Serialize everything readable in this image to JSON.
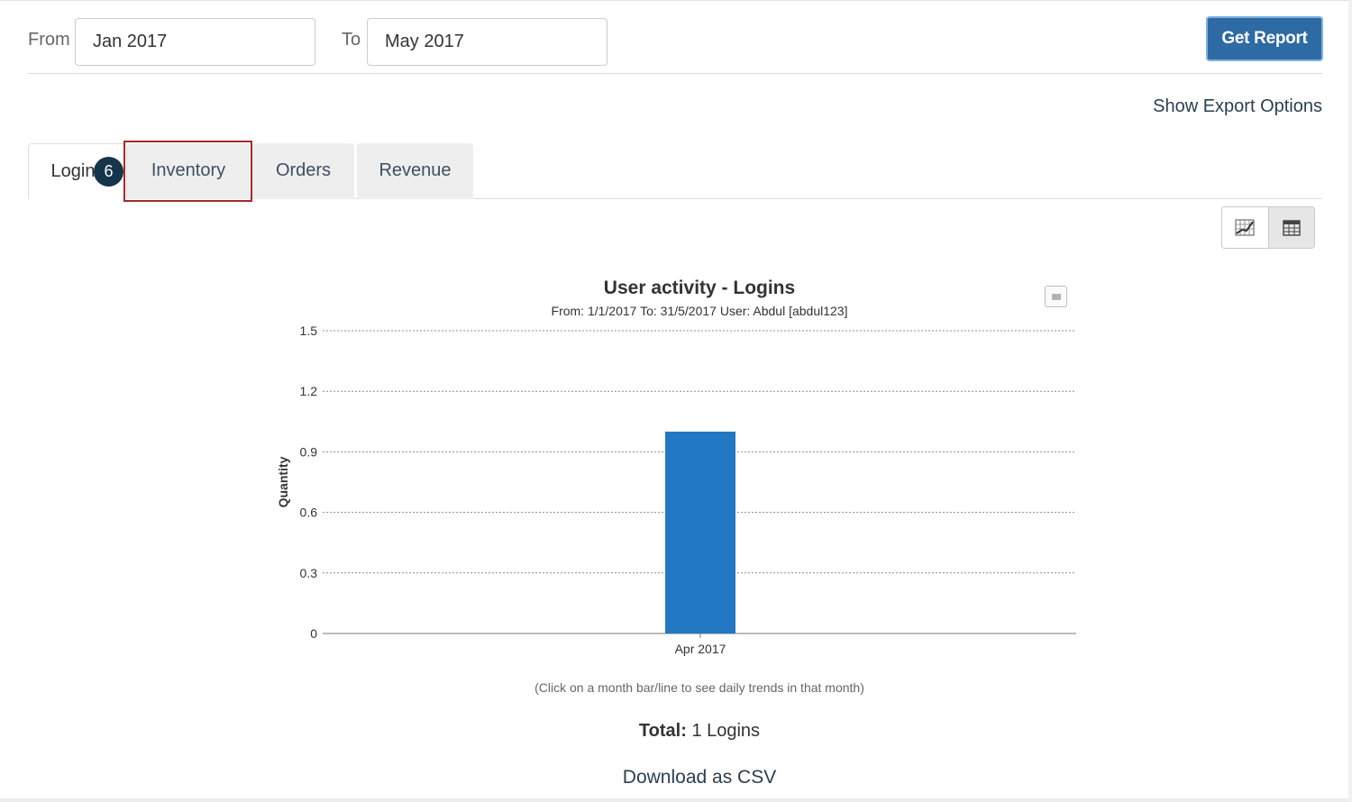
{
  "filters": {
    "from_label": "From",
    "from_value": "Jan 2017",
    "to_label": "To",
    "to_value": "May 2017",
    "get_report_label": "Get Report"
  },
  "export_options_label": "Show Export Options",
  "tabs": [
    {
      "label": "Login",
      "active": true
    },
    {
      "label": "Inventory",
      "active": false
    },
    {
      "label": "Orders",
      "active": false
    },
    {
      "label": "Revenue",
      "active": false
    }
  ],
  "step_badge": "6",
  "view_toggle": {
    "chart_icon": "bar-chart-icon",
    "table_icon": "table-grid-icon"
  },
  "chart_menu_icon": "menu-icon",
  "chart_data": {
    "type": "bar",
    "title": "User activity - Logins",
    "subtitle": "From: 1/1/2017 To: 31/5/2017 User: Abdul [abdul123]",
    "ylabel": "Quantity",
    "xlabel": "",
    "categories": [
      "Apr 2017"
    ],
    "values": [
      1
    ],
    "ylim": [
      0,
      1.5
    ],
    "yticks": [
      "0",
      "0.3",
      "0.6",
      "0.9",
      "1.2",
      "1.5"
    ],
    "grid": true,
    "bar_color": "#2278c2"
  },
  "hint_text": "(Click on a month bar/line to see daily trends in that month)",
  "total": {
    "label": "Total:",
    "value": "1 Logins"
  },
  "download_label": "Download as CSV",
  "colors": {
    "primary_button": "#2e6aa4",
    "highlight_border": "#a32a2a",
    "badge": "#15354a"
  }
}
